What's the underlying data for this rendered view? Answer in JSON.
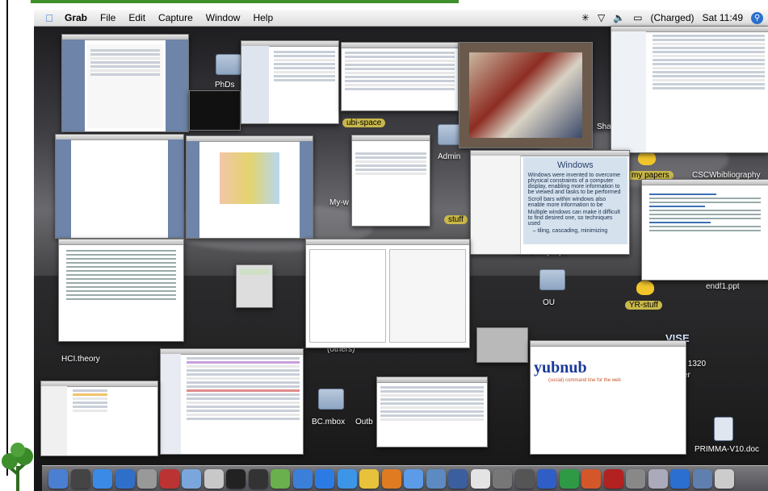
{
  "menubar": {
    "app_name": "Grab",
    "items": [
      "File",
      "Edit",
      "Capture",
      "Window",
      "Help"
    ],
    "status": {
      "battery": "(Charged)",
      "clock": "Sat 11:49"
    }
  },
  "desktop_labels": {
    "phds": "PhDs",
    "ubi_space": "ubi-space",
    "admin": "Admin",
    "sha": "Sha",
    "my_papers": "my papers",
    "cscw": "CSCWbibliography",
    "my_w": "My-w",
    "stuff": "stuff",
    "research_props": "research props",
    "end_ppt": "endf1.ppt",
    "ou": "OU",
    "yr_stuff": "YR-stuff",
    "hci_theory": "HCI.theory",
    "others": "(others)",
    "vise": "VISE",
    "x1320": "x 1320",
    "er": "er",
    "bc_mbox": "BC.mbox",
    "outb": "Outb",
    "primma": "PRIMMA-V10.doc"
  },
  "windows_slide": {
    "title": "Windows",
    "bullets": [
      "Windows were invented to overcome physical constraints of a computer display, enabling more information to be viewed and tasks to be performed",
      "Scroll bars within windows also enable more information to be",
      "Multiple windows can make it difficult to find desired one, so techniques used",
      "– tiling, cascading, minimizing"
    ]
  },
  "yubnub": {
    "logo": "yubnub",
    "tagline": "(social) command line for the web"
  },
  "colors": {
    "menubar_bg": "#e8e8e8",
    "accent": "#2b6fd0",
    "desktop": "#2f2f32"
  },
  "dock_icons": [
    "finder-icon",
    "dashboard-icon",
    "safari-icon",
    "mail-icon",
    "calculator-icon",
    "dictionary-icon",
    "downloads-icon",
    "preview-icon",
    "terminal-icon",
    "desktop-icon",
    "wmv-icon",
    "iconnect-icon",
    "ie-icon",
    "ichat-icon",
    "text-icon",
    "ibook-icon",
    "itunes-icon",
    "iphoto-icon",
    "imovie-icon",
    "ical-icon",
    "network-icon",
    "printer-icon",
    "word-icon",
    "excel-icon",
    "powerpoint-icon",
    "acrobat-icon",
    "sysprefs-icon",
    "grab-icon",
    "quicktime-icon",
    "applications-icon",
    "trash-icon"
  ]
}
